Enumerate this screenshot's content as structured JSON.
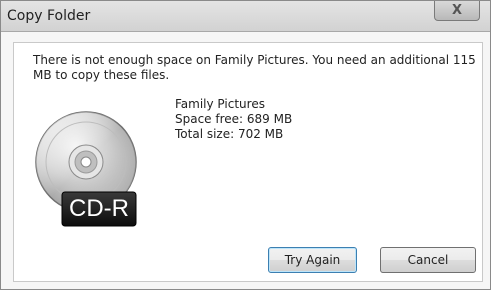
{
  "window": {
    "title": "Copy Folder",
    "close_glyph": "X"
  },
  "message": {
    "text": "There is not enough space on Family Pictures. You need an additional 115 MB to copy these files."
  },
  "drive": {
    "icon": "cd-r-disc-icon",
    "label": "CD-R",
    "name": "Family Pictures",
    "space_free": "Space free: 689 MB",
    "total_size": "Total size: 702 MB"
  },
  "buttons": {
    "try_again": "Try Again",
    "cancel": "Cancel"
  },
  "colors": {
    "default_button_border": "#3c7fb1",
    "disc_label_bg": "#1a1a1a"
  }
}
